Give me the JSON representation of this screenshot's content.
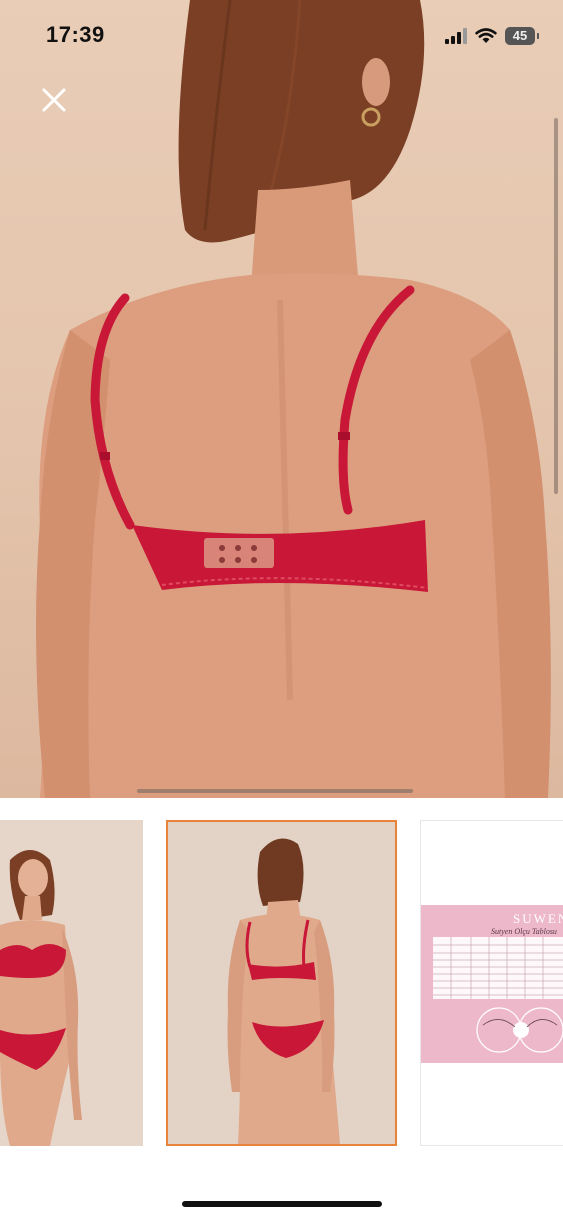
{
  "status_bar": {
    "time": "17:39",
    "battery_level": "45",
    "icons": [
      "cellular-signal-icon",
      "wifi-icon",
      "battery-icon"
    ]
  },
  "close_button": {
    "icon": "close-icon"
  },
  "gallery": {
    "selected_index": 1,
    "accent_color": "#e8833a",
    "thumbnails": [
      {
        "name": "front-view"
      },
      {
        "name": "back-view"
      },
      {
        "name": "size-chart"
      }
    ]
  },
  "size_chart": {
    "brand": "SUWEN",
    "title": "Sutyen Olçu Tablosu"
  },
  "colors": {
    "product_red": "#c81737",
    "background_skin": "#e6c8b1",
    "chart_pink": "#eeb8cb"
  }
}
